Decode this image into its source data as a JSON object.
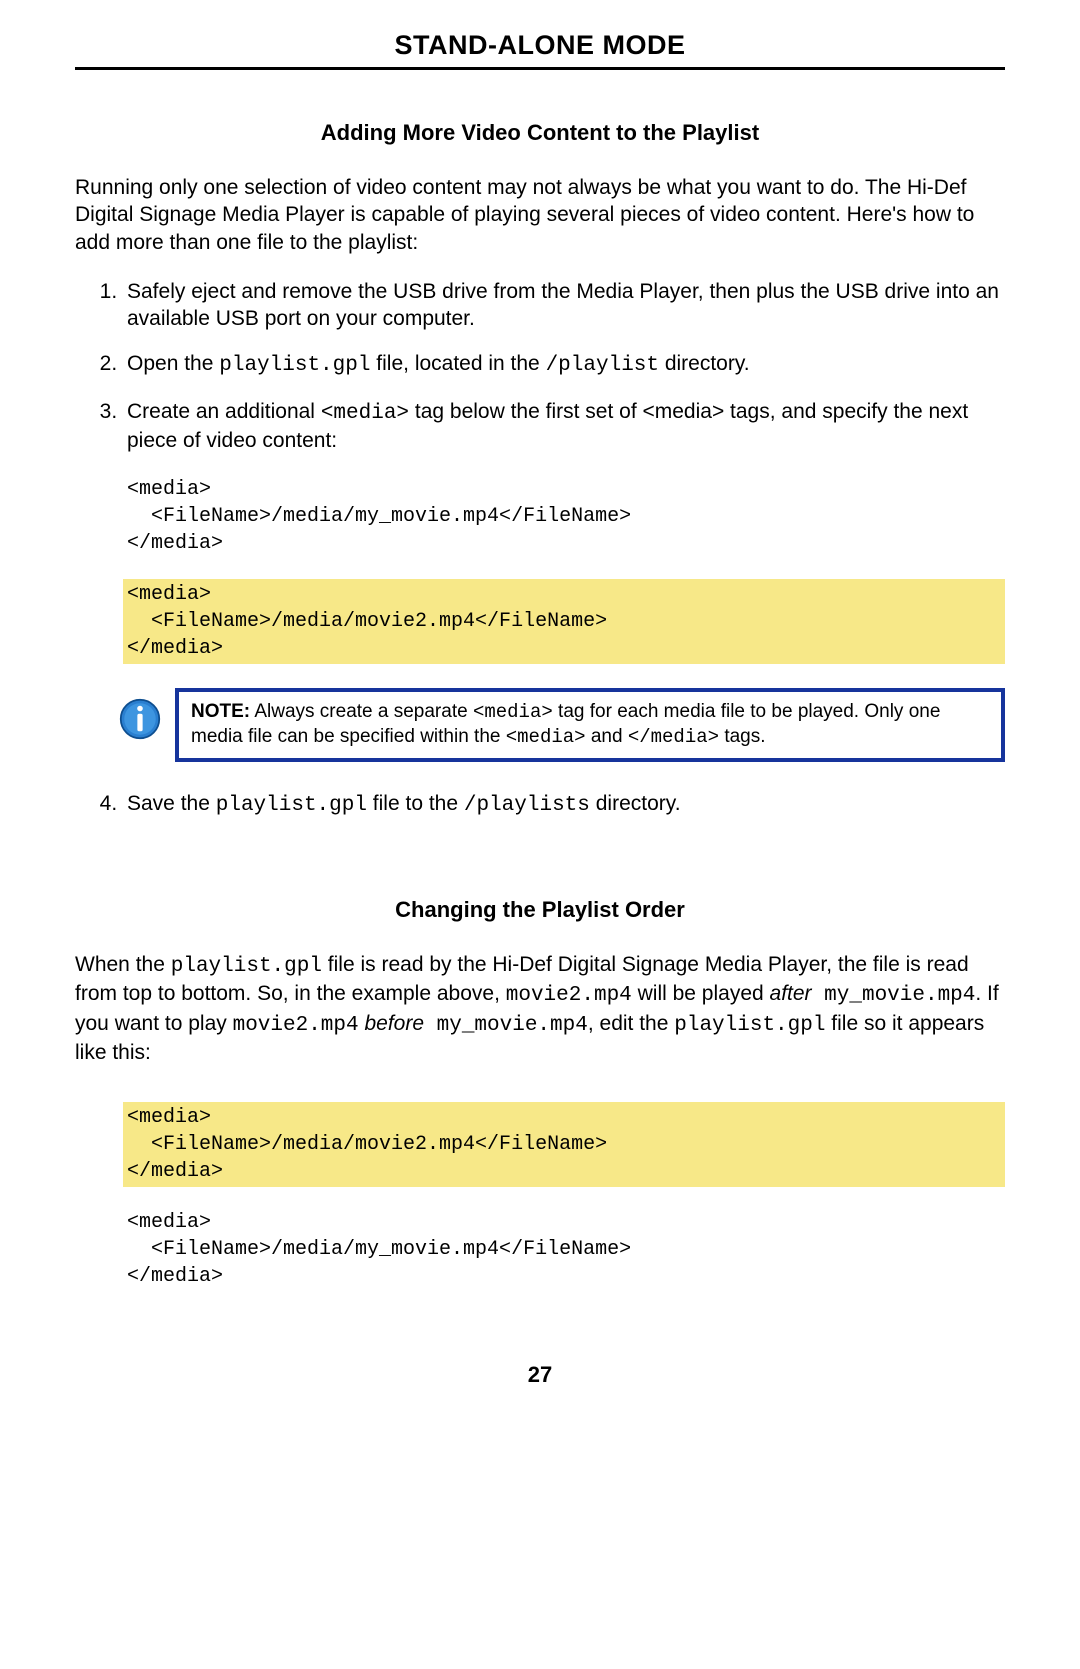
{
  "header": "STAND-ALONE MODE",
  "section1": {
    "title": "Adding More Video Content to the Playlist",
    "intro_a": "Running only one selection of video content may not always be what you want to do.  The Hi-Def Digital Signage Media Player is capable of playing several pieces of video content. Here's how to add more than one file to the playlist:",
    "step1": "Safely eject and remove the USB drive from the Media Player, then plus the USB drive into an available USB port on your computer.",
    "step2_a": "Open the ",
    "step2_code1": "playlist.gpl",
    "step2_b": " file, located in the ",
    "step2_code2": "/playlist",
    "step2_c": " directory.",
    "step3_a": "Create an additional ",
    "step3_code1": "<media>",
    "step3_b": " tag below the first set of <media> tags, and specify the next piece of video content:",
    "code_block_1": "<media>\n  <FileName>/media/my_movie.mp4</FileName>\n</media>",
    "code_block_2": "<media>\n  <FileName>/media/movie2.mp4</FileName>\n</media>",
    "note_label": "NOTE:",
    "note_a": " Always create a separate ",
    "note_code1": "<media>",
    "note_b": " tag for each media file to be played.  Only one media file can be specified within the ",
    "note_code2": "<media>",
    "note_c": " and ",
    "note_code3": "</media>",
    "note_d": " tags.",
    "step4_a": "Save the ",
    "step4_code1": "playlist.gpl",
    "step4_b": " file to the ",
    "step4_code2": "/playlists",
    "step4_c": " directory."
  },
  "section2": {
    "title": "Changing the Playlist Order",
    "p_a": "When the ",
    "p_code1": "playlist.gpl",
    "p_b": " file is read by the Hi-Def Digital Signage Media Player, the file is read from top to bottom.  So, in the example above, ",
    "p_code2": "movie2.mp4",
    "p_c": " will be played ",
    "p_ital1": "after",
    "p_code3": " my_movie.mp4",
    "p_d": ".  If you want to play ",
    "p_code4": "movie2.mp4",
    "p_e": " ",
    "p_ital2": "before",
    "p_code5": " my_movie.mp4",
    "p_f": ", edit the ",
    "p_code6": "playlist.gpl",
    "p_g": " file so it appears like this:",
    "code_block_1": "<media>\n  <FileName>/media/movie2.mp4</FileName>\n</media>",
    "code_block_2": "<media>\n  <FileName>/media/my_movie.mp4</FileName>\n</media>"
  },
  "page_number": "27"
}
